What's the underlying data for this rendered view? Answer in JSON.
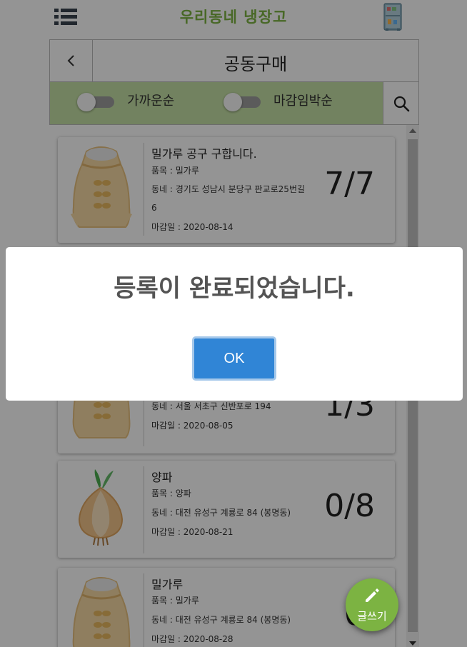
{
  "app": {
    "title": "우리동네 냉장고",
    "accent": "#7cb342",
    "menu_icon": "list-icon",
    "logo_icon": "fridge-icon"
  },
  "header": {
    "back_icon": "chevron-left-icon",
    "title": "공동구매"
  },
  "filters": {
    "toggle1_label": "가까운순",
    "toggle2_label": "마감임박순",
    "search_icon": "search-icon"
  },
  "posts": [
    {
      "title": "밀가루 공구 구합니다.",
      "item": "품목 : 밀가루",
      "location": "동네 : 경기도 성남시 분당구 판교로25번길 6",
      "deadline": "마감일 : 2020-08-14",
      "count": "7/7",
      "image": "flour-sack-icon"
    },
    {
      "title": "",
      "item": "",
      "location": "동네 : 서울 서초구 신반포로 194",
      "deadline": "마감일 : 2020-08-05",
      "count": "1/3",
      "image": "flour-sack-icon"
    },
    {
      "title": "양파",
      "item": "품목 : 양파",
      "location": "동네 : 대전 유성구 계룡로 84 (봉명동)",
      "deadline": "마감일 : 2020-08-21",
      "count": "0/8",
      "image": "onion-icon"
    },
    {
      "title": "밀가루",
      "item": "품목 : 밀가루",
      "location": "동네 : 대전 유성구 계룡로 84 (봉명동)",
      "deadline": "마감일 : 2020-08-28",
      "count": "0/",
      "image": "flour-sack-icon"
    }
  ],
  "modal": {
    "message": "등록이 완료되었습니다.",
    "ok_label": "OK",
    "ok_color": "#3085d6"
  },
  "fab": {
    "label": "글쓰기",
    "icon": "pencil-icon"
  }
}
